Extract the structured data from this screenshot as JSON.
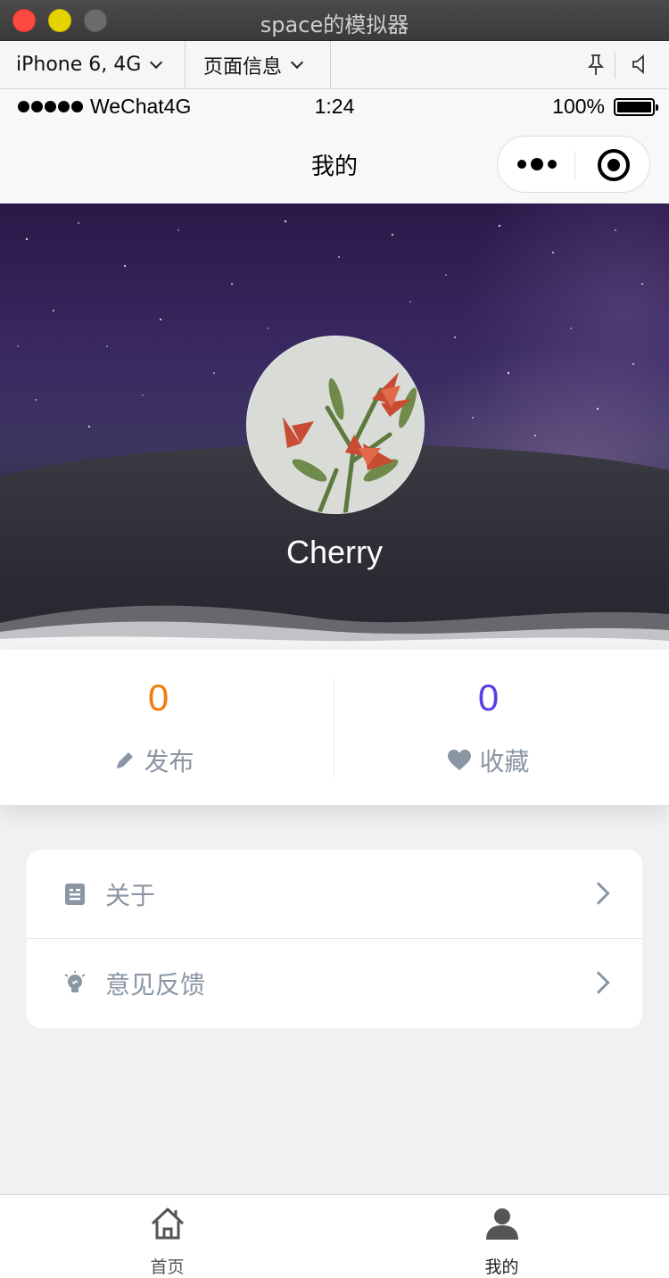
{
  "window": {
    "title": "space的模拟器"
  },
  "toolbar": {
    "device_select": "iPhone 6, 4G",
    "page_info_select": "页面信息"
  },
  "status_bar": {
    "carrier": "WeChat4G",
    "time": "1:24",
    "battery": "100%"
  },
  "navbar": {
    "title": "我的"
  },
  "profile": {
    "username": "Cherry"
  },
  "stats": {
    "posts": {
      "count": "0",
      "label": "发布",
      "color": "#f07d0c"
    },
    "favorites": {
      "count": "0",
      "label": "收藏",
      "color": "#5a3ee8"
    }
  },
  "menu": {
    "items": [
      {
        "label": "关于",
        "icon": "document-icon"
      },
      {
        "label": "意见反馈",
        "icon": "lightbulb-icon"
      }
    ]
  },
  "tabbar": {
    "tabs": [
      {
        "label": "首页",
        "icon": "home-icon",
        "active": false
      },
      {
        "label": "我的",
        "icon": "user-icon",
        "active": true
      }
    ]
  }
}
